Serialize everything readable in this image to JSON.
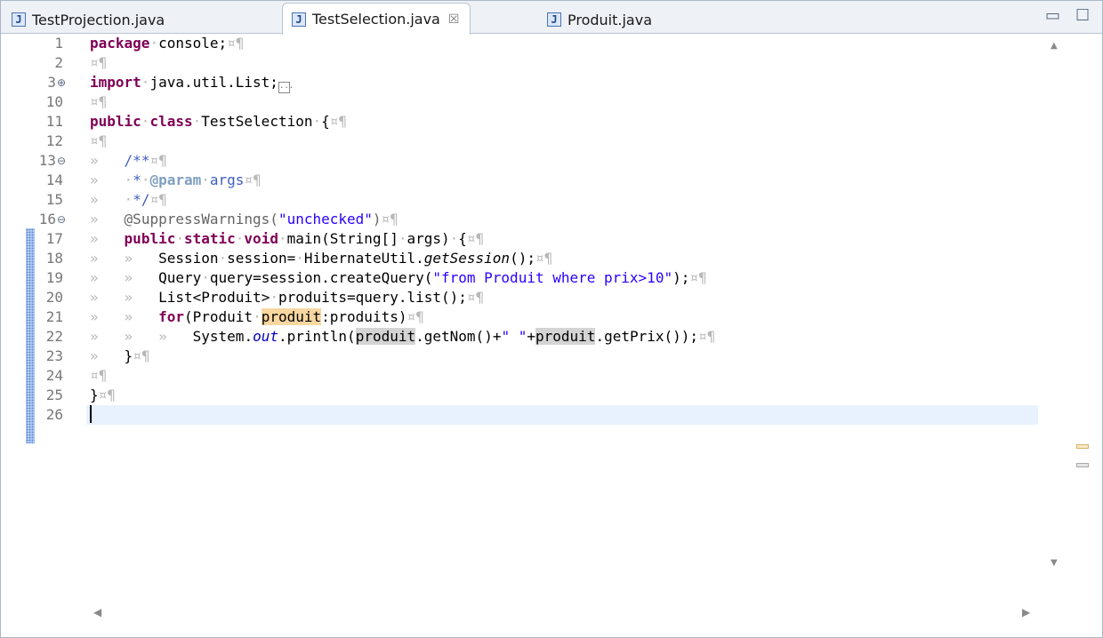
{
  "tabs": [
    {
      "label": "TestProjection.java",
      "icon": "J",
      "active": false
    },
    {
      "label": "TestSelection.java",
      "icon": "J",
      "active": true,
      "close": "☒"
    },
    {
      "label": "Produit.java",
      "icon": "J",
      "active": false
    }
  ],
  "window_controls": {
    "minimize": "▭",
    "maximize": "☐"
  },
  "line_numbers": [
    "1",
    "2",
    "3",
    "10",
    "11",
    "12",
    "13",
    "14",
    "15",
    "16",
    "17",
    "18",
    "19",
    "20",
    "21",
    "22",
    "23",
    "24",
    "25",
    "26"
  ],
  "fold_markers": {
    "expand": "⊕",
    "collapse": "⊖",
    "collapsed_box": "..."
  },
  "code": {
    "l1_kw": "package",
    "l1_rest": "console;",
    "l3_kw": "import",
    "l3_rest": "java.util.List;",
    "l11_kw1": "public",
    "l11_kw2": "class",
    "l11_rest": "TestSelection",
    "l13": "/**",
    "l14_star": "*",
    "l14_tag": "@param",
    "l14_name": "args",
    "l15": "*/",
    "l16_ann": "@SuppressWarnings(",
    "l16_str": "\"unchecked\"",
    "l16_close": ")",
    "l17_kw1": "public",
    "l17_kw2": "static",
    "l17_kw3": "void",
    "l17_a": "main(String[]",
    "l17_b": "args)",
    "l18_a": "Session",
    "l18_b": "session=",
    "l18_c": "HibernateUtil.",
    "l18_method": "getSession",
    "l18_d": "();",
    "l19_a": "Query",
    "l19_b": "query=session.createQuery(",
    "l19_str": "\"from Produit where prix>10\"",
    "l19_d": ");",
    "l20_a": "List<Produit>",
    "l20_b": "produits=query.list();",
    "l21_kw": "for",
    "l21_a": "(Produit",
    "l21_occ": "produit",
    "l21_b": ":produits)",
    "l22_a": "System.",
    "l22_field": "out",
    "l22_b": ".println(",
    "l22_occ1": "produit",
    "l22_c": ".getNom()+",
    "l22_str": "\" \"",
    "l22_d": "+",
    "l22_occ2": "produit",
    "l22_e": ".getPrix());",
    "l23": "}",
    "l25": "}"
  },
  "whitespace_marks": {
    "eol": "¤¶",
    "tab": "»",
    "space": "·"
  },
  "scroll": {
    "up": "▲",
    "down": "▼",
    "left": "◀",
    "right": "▶"
  },
  "colors": {
    "keyword": "#7f0055",
    "string": "#2a00ff",
    "javadoc": "#3f5fbf",
    "current_line": "#e8f2fe",
    "occurrence": "#d4d4d4",
    "write_occurrence": "#f8d7a0"
  }
}
